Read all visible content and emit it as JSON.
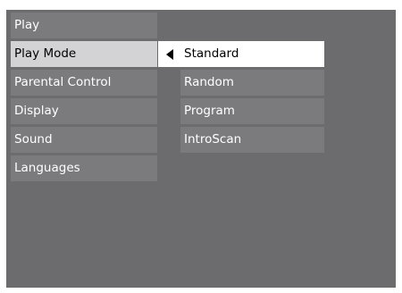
{
  "menu": {
    "items": [
      {
        "label": "Play"
      },
      {
        "label": "Play Mode"
      },
      {
        "label": "Parental Control"
      },
      {
        "label": "Display"
      },
      {
        "label": "Sound"
      },
      {
        "label": "Languages"
      }
    ],
    "active_item": "Play Mode"
  },
  "submenu": {
    "items": [
      {
        "label": "Standard"
      },
      {
        "label": "Random"
      },
      {
        "label": "Program"
      },
      {
        "label": "IntroScan"
      }
    ],
    "selected_item": "Standard",
    "selector_icon": "triangle-left-icon"
  },
  "colors": {
    "screen_background": "#6c6c6e",
    "item_background": "#7b7b7d",
    "active_background": "#d3d3d5",
    "selected_background": "#ffffff"
  }
}
